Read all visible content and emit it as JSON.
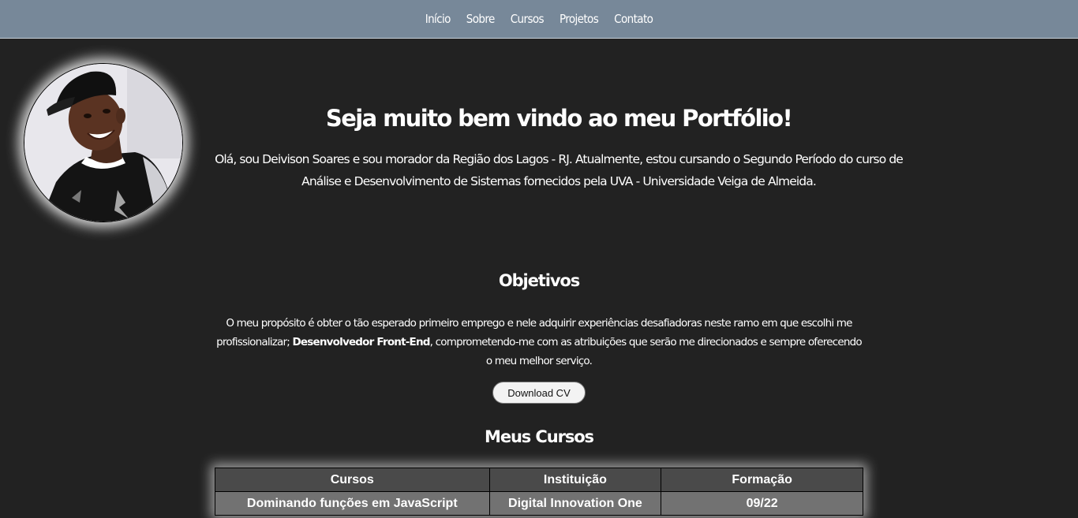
{
  "nav": {
    "items": [
      {
        "label": "Início"
      },
      {
        "label": "Sobre"
      },
      {
        "label": "Cursos"
      },
      {
        "label": "Projetos"
      },
      {
        "label": "Contato"
      }
    ]
  },
  "profile": {
    "avatar_icon": "profile-photo"
  },
  "intro": {
    "title": "Seja muito bem vindo ao meu Portfólio!",
    "text": "Olá, sou Deivison Soares e sou morador da Região dos Lagos - RJ. Atualmente, estou cursando o Segundo Período do curso de Análise e Desenvolvimento de Sistemas fornecidos pela UVA - Universidade Veiga de Almeida."
  },
  "objectives": {
    "title": "Objetivos",
    "text_before": "O meu propósito é obter o tão esperado primeiro emprego e nele adquirir experiências desafiadoras neste ramo em que escolhi me profissionalizar; ",
    "text_bold": "Desenvolvedor Front-End",
    "text_after": ", comprometendo-me com as atribuições que serão me direcionados e sempre oferecendo o meu melhor serviço.",
    "download_label": "Download CV"
  },
  "courses": {
    "title": "Meus Cursos",
    "headers": {
      "course": "Cursos",
      "institution": "Instituição",
      "date": "Formação"
    },
    "rows": [
      {
        "course": "Dominando funções em JavaScript",
        "institution": "Digital Innovation One",
        "date": "09/22"
      }
    ]
  },
  "colors": {
    "background": "#222222",
    "navbar": "#778899",
    "table_header": "#4a4a4a",
    "table_row": "#727272"
  }
}
